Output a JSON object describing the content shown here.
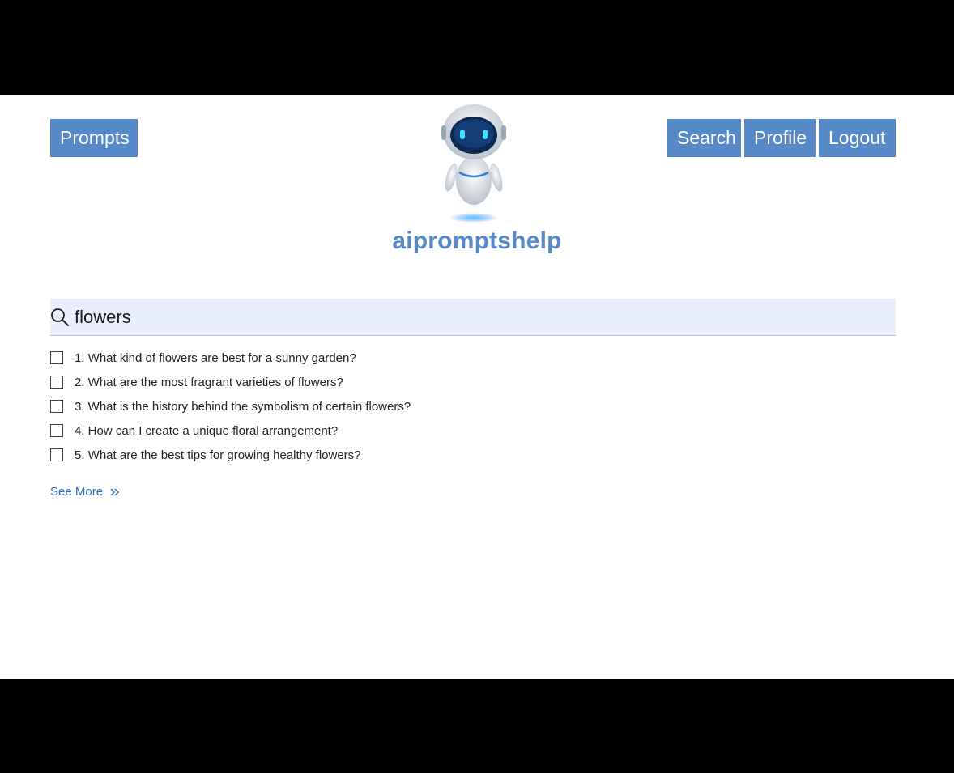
{
  "nav": {
    "prompts_label": "Prompts",
    "search_label": "Search",
    "profile_label": "Profile",
    "logout_label": "Logout"
  },
  "brand": {
    "name": "aipromptshelp",
    "logo_icon": "robot-mascot-icon"
  },
  "search": {
    "icon": "search-icon",
    "value": "flowers"
  },
  "results": [
    "1. What kind of flowers are best for a sunny garden?",
    "2. What are the most fragrant varieties of flowers?",
    "3. What is the history behind the symbolism of certain flowers?",
    "4. How can I create a unique floral arrangement?",
    "5. What are the best tips for growing healthy flowers?"
  ],
  "see_more": {
    "label": "See More",
    "icon": "double-chevron-right-icon"
  },
  "colors": {
    "accent": "#5689c8",
    "search_bg": "#e8eefb",
    "link": "#2f6fbf"
  }
}
